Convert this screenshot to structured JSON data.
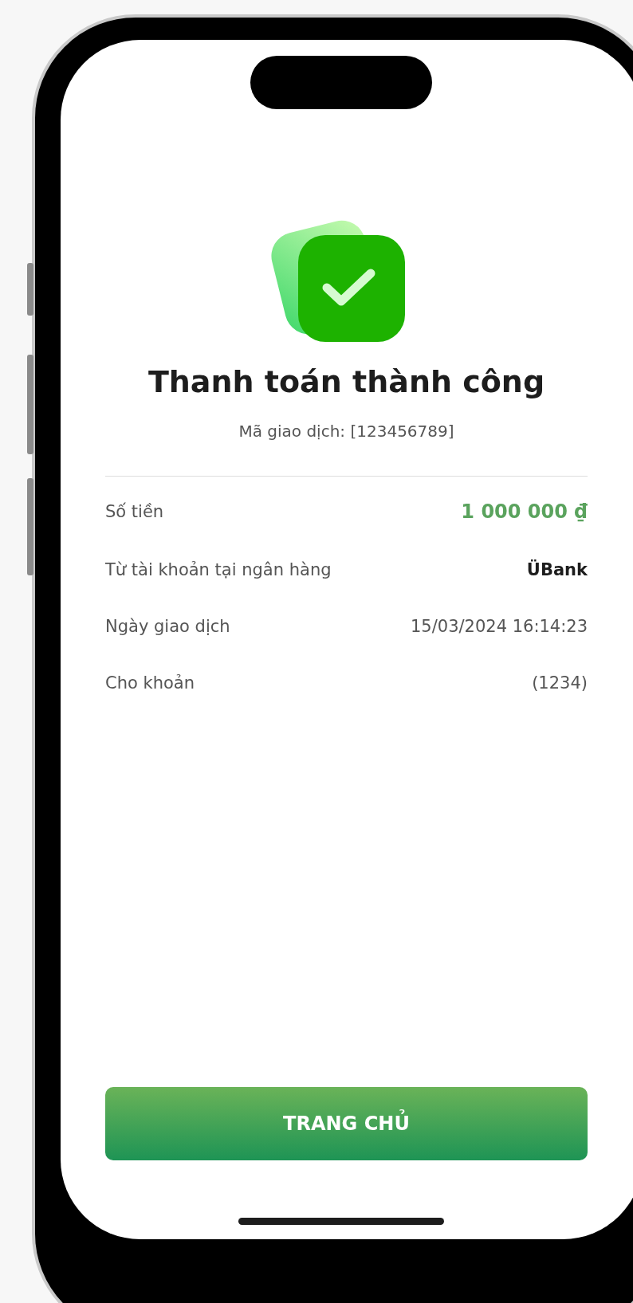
{
  "title": "Thanh toán thành công",
  "transaction_id": "Mã giao dịch: [123456789]",
  "details": [
    {
      "label": "Số tiền",
      "value": "1 000 000 ₫",
      "kind": "amount"
    },
    {
      "label": "Từ tài khoản tại ngân hàng",
      "value": "ÜBank",
      "kind": "bold"
    },
    {
      "label": "Ngày giao dịch",
      "value": "15/03/2024 16:14:23",
      "kind": "plain"
    },
    {
      "label": "Cho khoản",
      "value": "(1234)",
      "kind": "plain"
    }
  ],
  "button": {
    "label": "TRANG CHỦ"
  }
}
